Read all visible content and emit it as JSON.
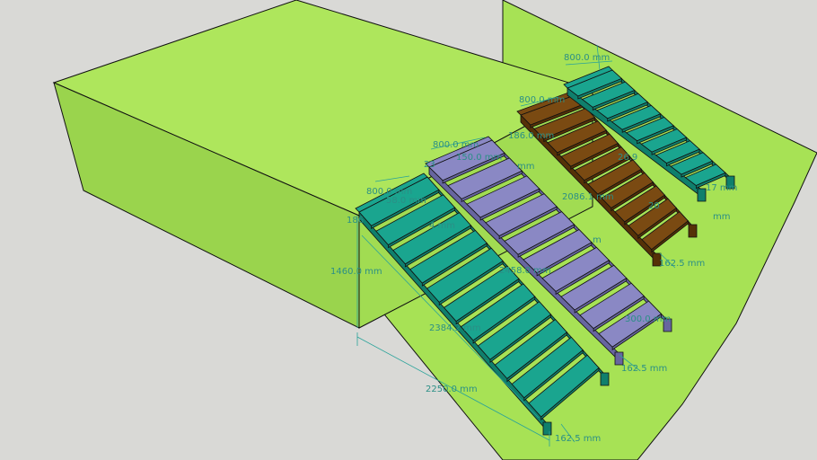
{
  "colors": {
    "background": "#d9d9d6",
    "terrain_top": "#aee65c",
    "terrain_side": "#a1dc52",
    "terrain_front": "#9ad44d",
    "ground": "#a7e255",
    "edge": "#111111",
    "stair_teal": "#1aa58f",
    "stair_teal_dark": "#0f7f6c",
    "stair_purple": "#8a88c4",
    "stair_purple_dark": "#67659f",
    "stair_brown": "#7a4a12",
    "stair_brown_dark": "#553107",
    "dimension": "#2b8f86"
  },
  "stairs": [
    {
      "name": "stair-teal-front",
      "steps": 11,
      "color": "stair_teal"
    },
    {
      "name": "stair-purple",
      "steps": 10,
      "color": "stair_purple"
    },
    {
      "name": "stair-brown",
      "steps": 10,
      "color": "stair_brown"
    },
    {
      "name": "stair-teal-back",
      "steps": 9,
      "color": "stair_teal"
    }
  ],
  "dimensions": {
    "front_width": "800.0 mm",
    "front_riser_partial": "186",
    "front_side_partial": "58.0 mm",
    "front_height": "1460.0 mm",
    "front_slope": "2384.2 mm",
    "front_run": "2250.0 mm",
    "front_foot": "162.5 mm",
    "front_side_partial2": "4 mm",
    "purple_width": "800.0 mm",
    "purple_partial1": "23",
    "purple_partial2": "150.0 mm",
    "purple_partial3": "mm",
    "purple_slope": "2458.0 mm",
    "purple_inner": "m",
    "purple_end": "300.0 mm",
    "purple_foot": "162.5 mm",
    "brown_width": "800.0 mm",
    "brown_riser": "186.0 mm",
    "brown_slope": "2086.1 mm",
    "brown_partial": "20",
    "brown_foot": "162.5 mm",
    "back_width": "800.0 mm",
    "back_slope": "26.9",
    "back_partial": "17 mm",
    "back_foot": "mm"
  }
}
